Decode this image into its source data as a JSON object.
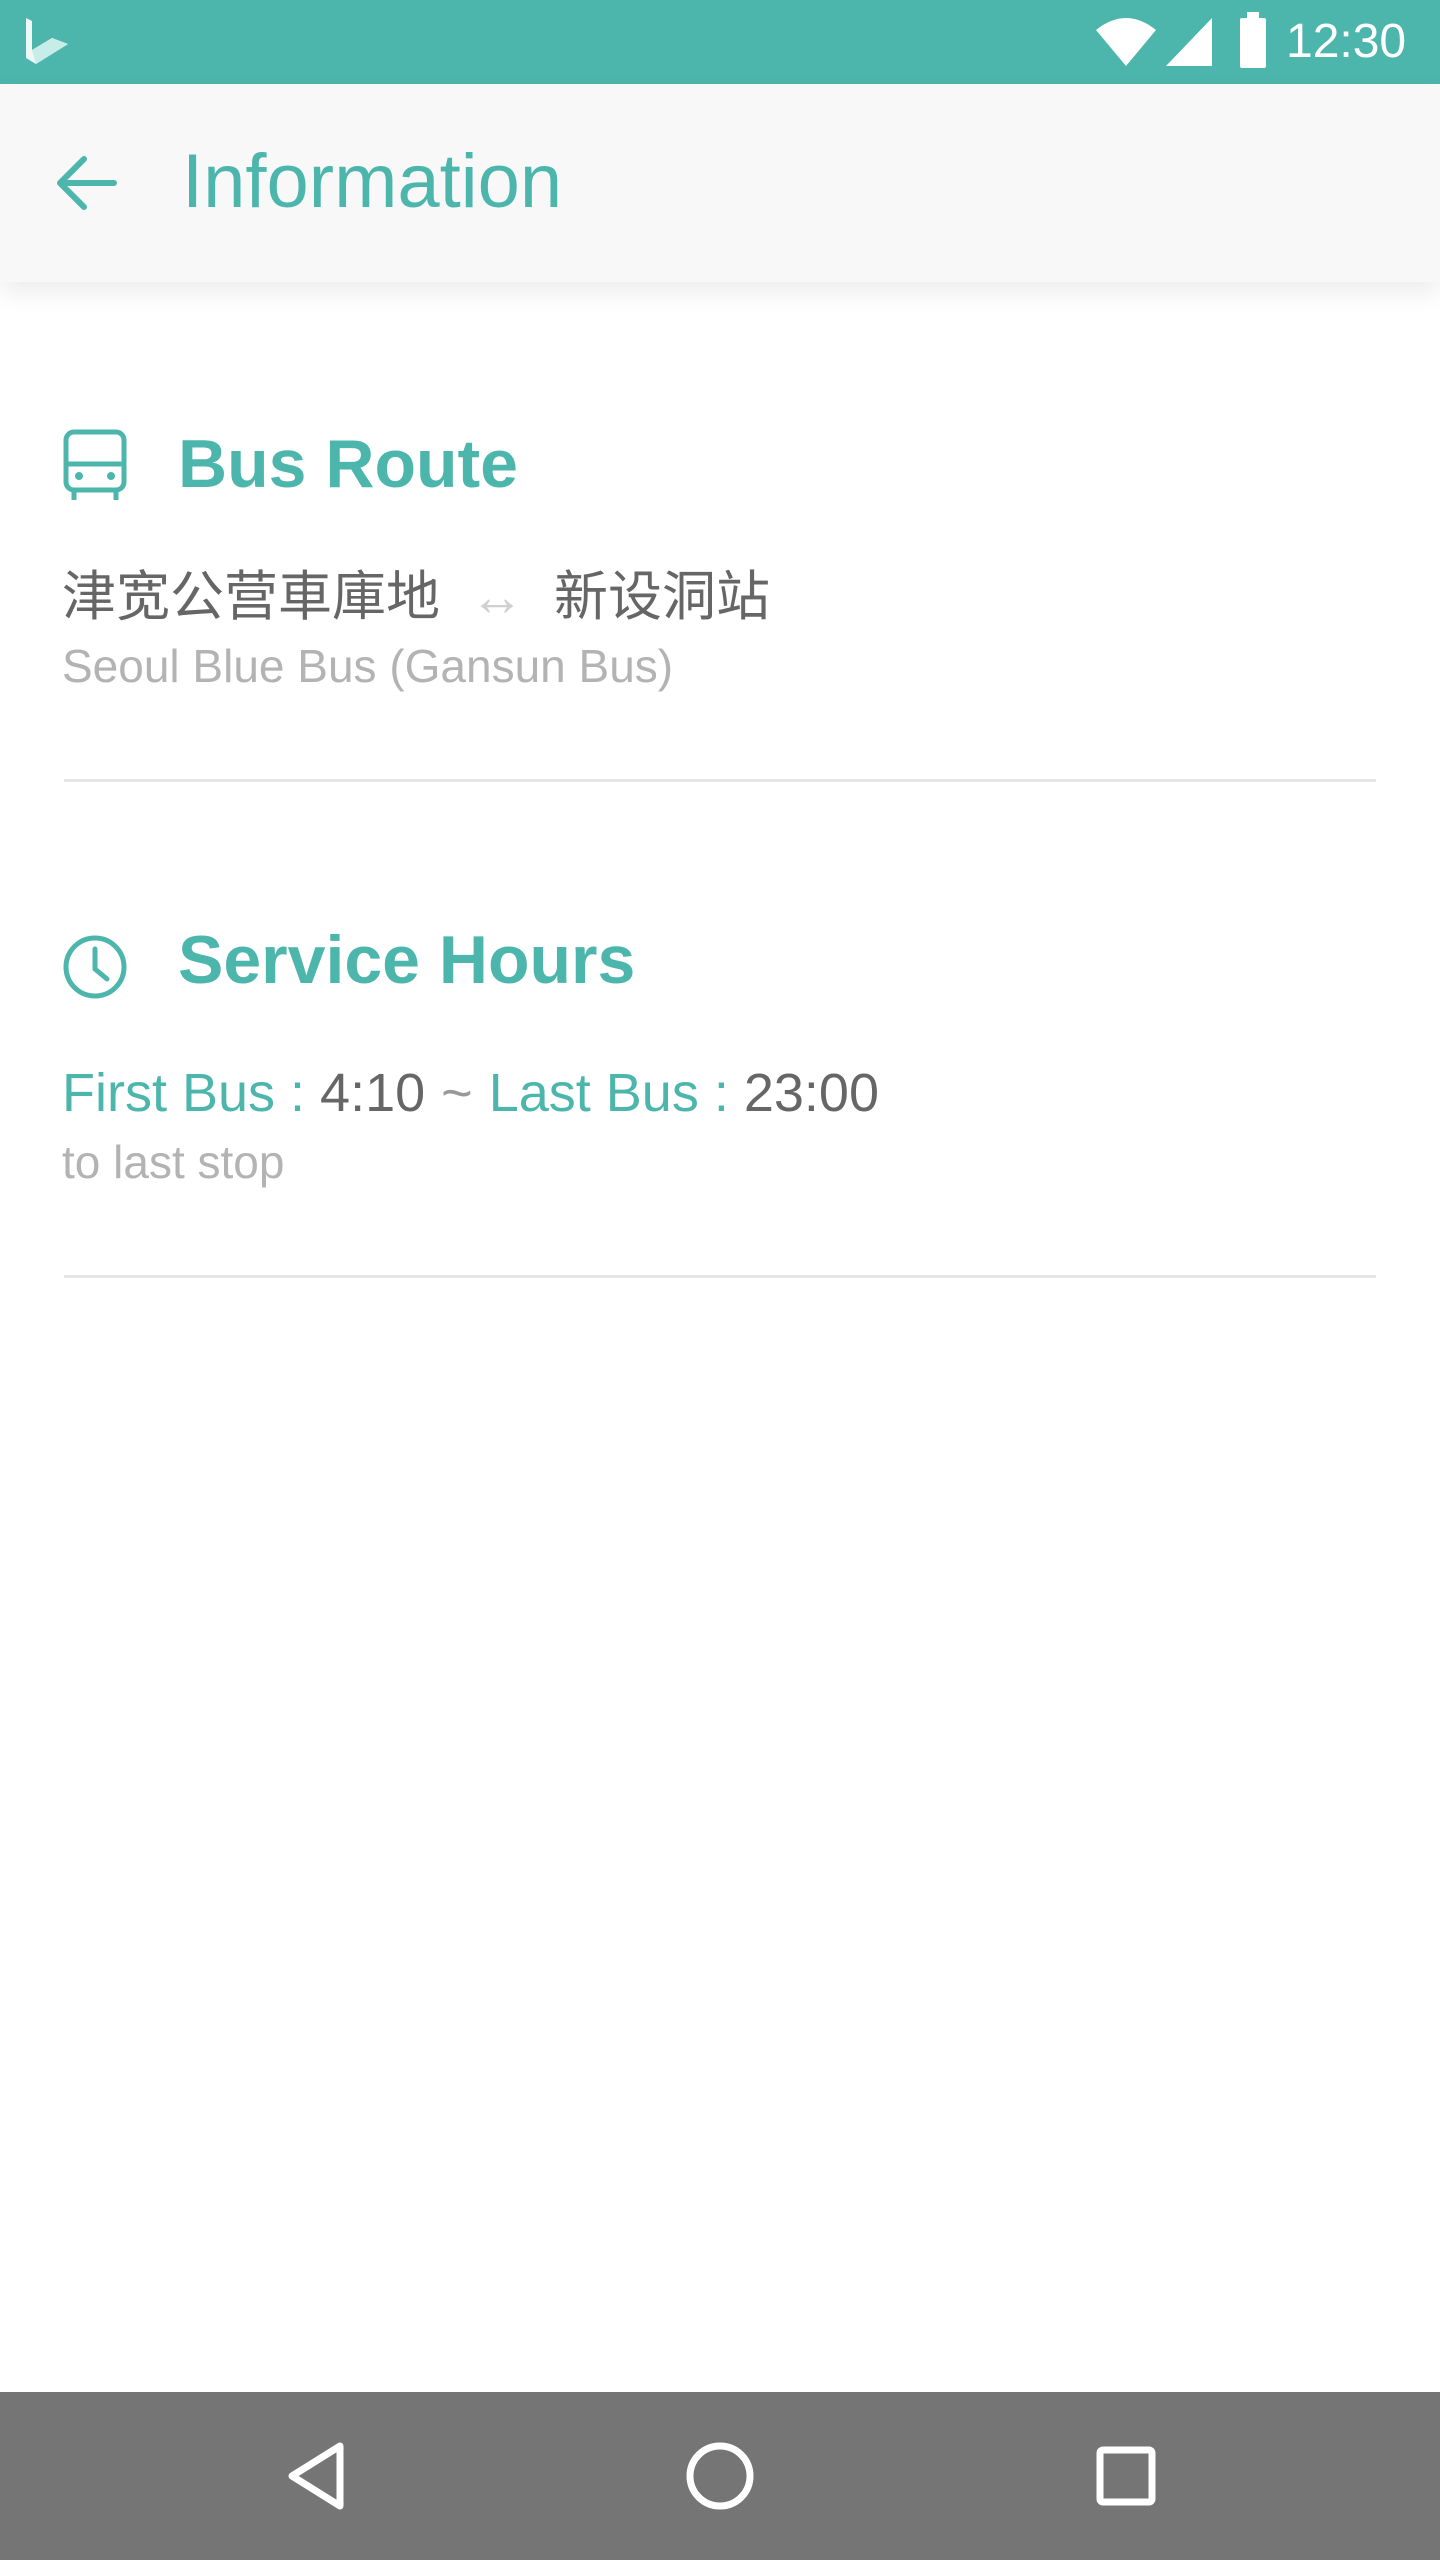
{
  "status_bar": {
    "time": "12:30",
    "icons": [
      "app-logo-icon",
      "wifi-icon",
      "signal-icon",
      "battery-icon"
    ],
    "background": "#4db6ac"
  },
  "app_bar": {
    "title": "Information",
    "back_icon": "arrow-left-icon",
    "accent": "#4db6ac"
  },
  "bus_route": {
    "title": "Bus Route",
    "icon": "bus-icon",
    "origin": "津宽公营車庫地",
    "arrow": "↔",
    "destination": "新设洞站",
    "operator": "Seoul Blue Bus (Gansun Bus)"
  },
  "service_hours": {
    "title": "Service Hours",
    "icon": "clock-icon",
    "first_label": "First Bus :",
    "first_time": "4:10",
    "separator": "~",
    "last_label": "Last Bus :",
    "last_time": "23:00",
    "note": "to last stop"
  },
  "nav_bar": {
    "buttons": [
      "back-triangle-icon",
      "home-circle-icon",
      "recents-square-icon"
    ]
  }
}
